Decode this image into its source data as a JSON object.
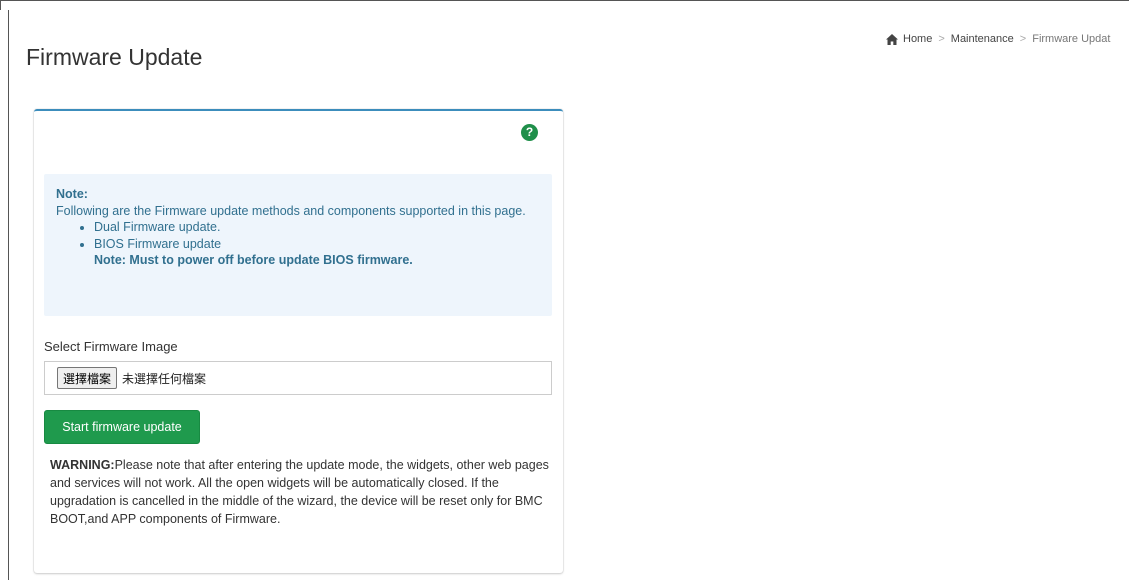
{
  "page": {
    "title": "Firmware Update"
  },
  "breadcrumb": {
    "items": [
      "Home",
      "Maintenance",
      "Firmware Updat"
    ],
    "separator": ">",
    "home_icon": "home-icon"
  },
  "panel": {
    "accent_color": "#3c8dbc",
    "help_icon": "question-circle-icon",
    "help_glyph": "?",
    "note": {
      "title": "Note:",
      "intro": "Following are the Firmware update methods and components supported in this page.",
      "items": [
        "Dual Firmware update.",
        "BIOS Firmware update"
      ],
      "bios_note": "Note: Must to power off before update BIOS firmware."
    },
    "select_label": "Select Firmware Image",
    "file_input": {
      "button_label": "選擇檔案",
      "status": "未選擇任何檔案"
    },
    "start_button": {
      "label": "Start firmware update",
      "color": "#1f9a4d"
    },
    "warning": {
      "label": "WARNING:",
      "text": "Please note that after entering the update mode, the widgets, other web pages and services will not work. All the open widgets will be automatically closed. If the upgradation is cancelled in the middle of the wizard, the device will be reset only for BMC BOOT,and APP components of Firmware."
    }
  }
}
